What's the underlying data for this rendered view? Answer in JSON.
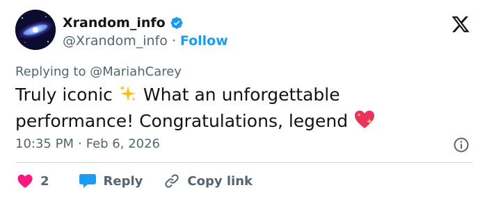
{
  "author": {
    "display_name": "Xrandom_info",
    "handle": "@Xrandom_info",
    "separator": "·",
    "follow_label": "Follow",
    "avatar_icon": "galaxy-avatar",
    "verified_icon": "verified-badge-icon"
  },
  "platform_logo": "x-logo-icon",
  "reply_context": {
    "prefix": "Replying to",
    "mention": "@MariahCarey"
  },
  "tweet": {
    "line1_text": "Truly iconic",
    "line1_emoji": "sparkles-emoji",
    "line1_rest": "What an unforgettable",
    "line2_text": "performance! Congratulations, legend",
    "line2_emoji": "sparkling-heart-emoji"
  },
  "meta": {
    "time": "10:35 PM",
    "separator": "·",
    "date": "Feb 6, 2026",
    "info_icon": "info-icon"
  },
  "actions": {
    "like_count": "2",
    "reply_label": "Reply",
    "copy_link_label": "Copy link"
  },
  "colors": {
    "accent": "#1d9bf0",
    "like": "#f91880",
    "text": "#0f1419",
    "secondary": "#536471",
    "divider": "#cfd9de"
  }
}
